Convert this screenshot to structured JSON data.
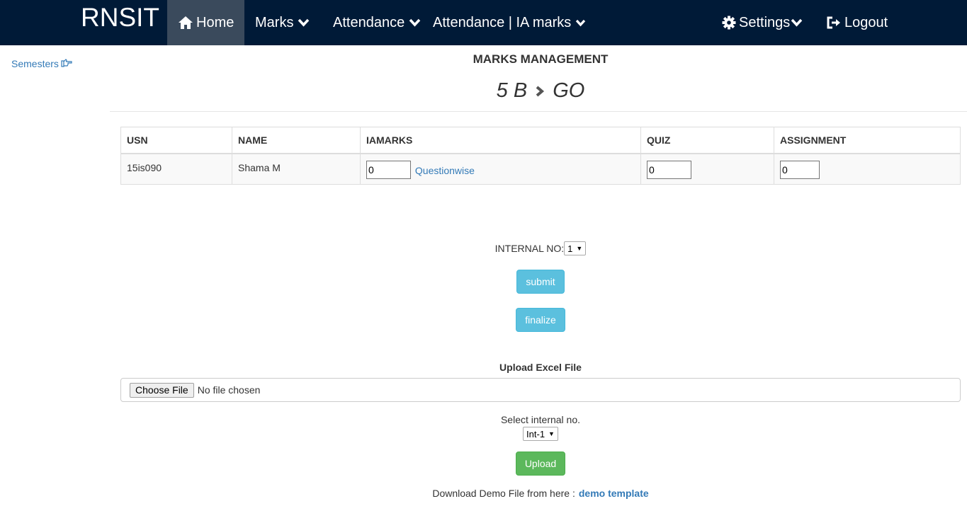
{
  "navbar": {
    "brand": "RNSIT",
    "items": [
      {
        "label": "Home",
        "icon": "home-icon"
      },
      {
        "label": "Marks",
        "icon": "chevron-down-icon"
      },
      {
        "label": "Attendance",
        "icon": "chevron-down-icon"
      },
      {
        "label": "Attendance | IA marks",
        "icon": "chevron-down-icon"
      },
      {
        "label": "Settings",
        "icon": "gear-icon"
      },
      {
        "label": "Logout",
        "icon": "logout-icon"
      }
    ],
    "colors": {
      "background": "#001a37",
      "active": "#3a4a5c"
    }
  },
  "sidebar": {
    "semesters_label": "Semesters",
    "icon": "hand-point-right-icon"
  },
  "header": {
    "title": "MARKS MANAGEMENT",
    "breadcrumb": [
      "5 B",
      "GO"
    ]
  },
  "table": {
    "columns": [
      "USN",
      "NAME",
      "IAMARKS",
      "QUIZ",
      "ASSIGNMENT"
    ],
    "rows": [
      {
        "usn": "15is090",
        "name": "Shama M",
        "iamarks": "0",
        "questionwise": "Questionwise",
        "quiz": "0",
        "assignment": "0"
      }
    ]
  },
  "internal": {
    "label": "INTERNAL NO:",
    "selected": "1"
  },
  "buttons": {
    "submit": "submit",
    "finalize": "finalize",
    "upload": "Upload"
  },
  "upload": {
    "title": "Upload Excel File",
    "choose_label": "Choose File",
    "no_file": "No file chosen",
    "select_label": "Select internal no.",
    "select_value": "Int-1"
  },
  "demo": {
    "text": "Download Demo File from here :",
    "link": "demo template"
  },
  "colors": {
    "link": "#337ab7",
    "info": "#5bc0de",
    "success": "#5cb85c"
  }
}
